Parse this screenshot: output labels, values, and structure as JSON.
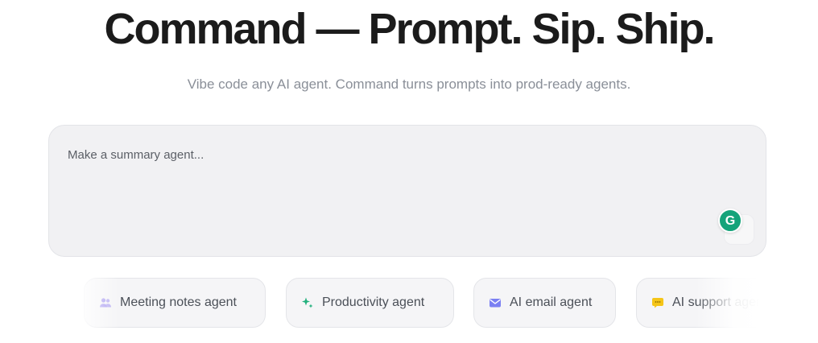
{
  "hero": {
    "title": "Command — Prompt. Sip. Ship.",
    "subtitle": "Vibe code any AI agent. Command turns prompts into prod-ready agents."
  },
  "prompt": {
    "placeholder": "Make a summary agent...",
    "value": "",
    "assistant_icon": "grammarly-g-icon",
    "assistant_letter": "G"
  },
  "suggestions": [
    {
      "label": "Meeting notes agent",
      "icon": "people-icon",
      "icon_color": "#a99cf0"
    },
    {
      "label": "Productivity agent",
      "icon": "sparkle-icon",
      "icon_color": "#22b07d"
    },
    {
      "label": "AI email agent",
      "icon": "envelope-icon",
      "icon_color": "#7b80f2"
    },
    {
      "label": "AI support agent",
      "icon": "chat-bubble-icon",
      "icon_color": "#f5c518"
    }
  ],
  "colors": {
    "title": "#1b1b1b",
    "subtitle": "#8a8f98",
    "panel_bg": "#f1f1f3",
    "assistant_green": "#15a37a"
  }
}
